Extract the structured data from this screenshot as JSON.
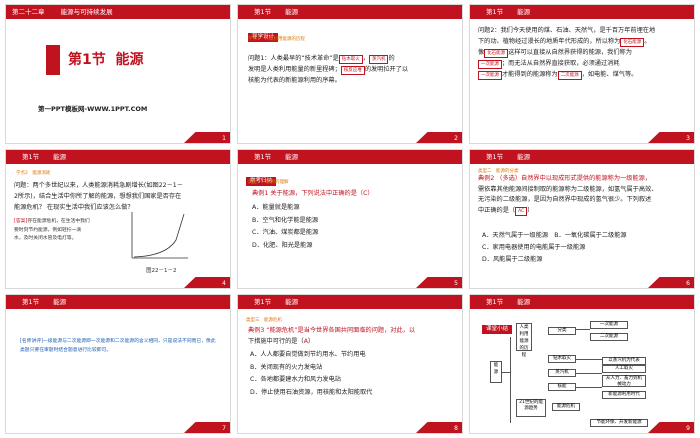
{
  "slides": [
    {
      "num": "1",
      "chapter": "第二十二章",
      "chapter_title": "能源与可持续发展",
      "title_num": "第1节",
      "title": "能源",
      "subtitle": "第一PPT模板网-WWW.1PPT.COM"
    },
    {
      "num": "2",
      "bar_section": "第1节",
      "bar_title": "能源",
      "tag": "导学设计",
      "sub": "学点1　人类利用能源的历程",
      "lines": [
        "问题1：人类最早的“技术革命”是",
        "，",
        "的",
        "发明是人类利用能量的新里程碑；",
        "的发明拉开了以",
        "核能为代表的新能源利用的序幕。"
      ],
      "answers": [
        "钻木取火",
        "蒸汽机",
        "核反应堆"
      ]
    },
    {
      "num": "3",
      "bar_section": "第1节",
      "bar_title": "能源",
      "lines": [
        "问题2：我们今天使用的煤、石油、天然气，是千百万年前埋在地",
        "下的动、植物经过漫长的地质年代形成的，所以称为",
        "。",
        "像",
        "这样可以直接从自然界获得的能源，我们称为",
        "；而无法从自然界直接获取，必须通过消耗",
        "才能得到的能源称为",
        "，如电能、煤气等。"
      ],
      "answers": [
        "化石能源",
        "化石能源",
        "一次能源",
        "一次能源",
        "二次能源"
      ]
    },
    {
      "num": "4",
      "bar_section": "第1节",
      "bar_title": "能源",
      "sub": "学点2　能源消耗",
      "lines": [
        "问题：两个多世纪以来，人类能源消耗急剧增长(如图22－1－",
        "2所示)，结合生活中你所了解的能源，想想我们国家是否存在",
        "能源危机？ 在现实生活中我们应该怎么做？"
      ],
      "hint_tag": "[答案]",
      "hint_lines": [
        "存在能源危机，在生活中我们",
        "要时刻节约能源，例如轻拧一滴",
        "水，及时关闭水管及电灯等。"
      ],
      "fig_caption": "图22－1－2"
    },
    {
      "num": "5",
      "bar_section": "第1节",
      "bar_title": "能源",
      "tag": "常考归纳",
      "sub": "类型一　能源的理解",
      "q": "典例1 关于能源，下列说法中正确的是（",
      "ans": "C",
      "options": [
        "A．能量就是能源",
        "B．空气和化学能是能源",
        "C．汽油、煤炭都是能源",
        "D．化肥、阳光是能源"
      ]
    },
    {
      "num": "6",
      "bar_section": "第1节",
      "bar_title": "能源",
      "sub": "类型二　能源的分类",
      "lines": [
        "典例2 （多选）自然界中以现成形式提供的能源称为一级能源，",
        "需依靠其他能源间接制取的能源称为二级能源，如氢气属于高效、",
        "无污染的二级能源，是因为自然界中现成的氢气很少。下列叙述",
        "中正确的是（",
        "）"
      ],
      "ans": "AC",
      "options": [
        "A．天然气属于一级能源　B．一氧化碳属于二级能源",
        "C．家用电器使用的电能属于一级能源",
        "D．风能属于二级能源"
      ]
    },
    {
      "num": "7",
      "bar_section": "第1节",
      "bar_title": "能源",
      "note": "[名师讲评]一级能源与二次能源即一次能源和二次能源的含义相同，只是说法不同而已，像此类题只要在审题时结合题意进行比较即可。"
    },
    {
      "num": "8",
      "bar_section": "第1节",
      "bar_title": "能源",
      "sub": "类型三　能源危机",
      "q": "典例3 “能源危机”是当今世界各国共同面临的问题，对此，以",
      "q2": "下措施中可行的是（",
      "ans": "A",
      "options": [
        "A．人人都要自觉做到节约用水、节约用电",
        "B．关闭现有的火力发电站",
        "C．各地都要建水力和风力发电站",
        "D．停止使用石油资源，用核能和太阳能取代"
      ]
    },
    {
      "num": "9",
      "bar_section": "第1节",
      "bar_title": "能源",
      "tag": "课堂小结",
      "nodes": [
        "能源",
        "人类利用能源的历程",
        "钻木取火",
        "蒸汽机",
        "核能",
        "分类",
        "一次能源",
        "二次能源",
        "能源消耗",
        "能源危机",
        "节约能源",
        "以蒸汽机为代表",
        "人工取火",
        "从人力、畜力到机械动力",
        "新能源利用时代",
        "21世纪的能源趋势",
        "节能环保、开发新能源"
      ]
    }
  ],
  "colors": {
    "accent": "#c1121f"
  }
}
